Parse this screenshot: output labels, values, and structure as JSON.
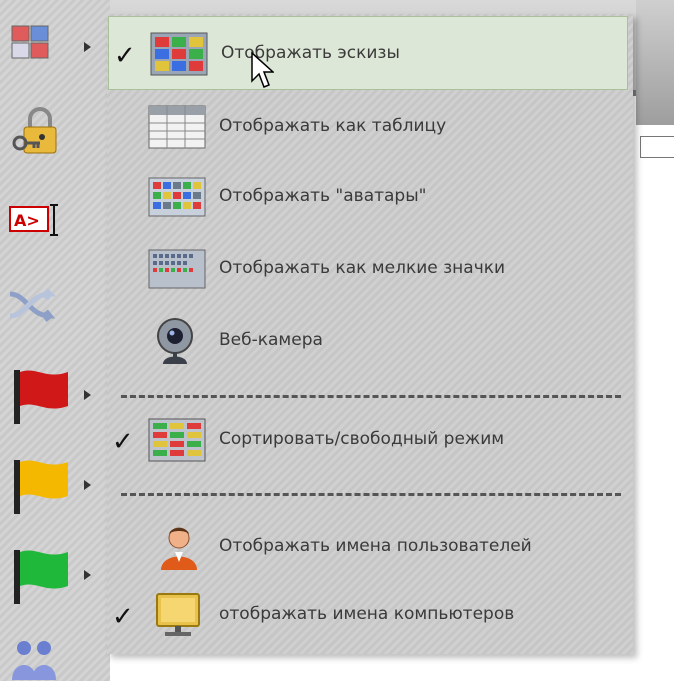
{
  "menu": {
    "items": [
      {
        "label": "Отображать эскизы",
        "checked": true,
        "icon": "thumbnails-icon"
      },
      {
        "label": "Отображать как таблицу",
        "checked": false,
        "icon": "table-view-icon"
      },
      {
        "label": "Отображать \"аватары\"",
        "checked": false,
        "icon": "avatars-icon"
      },
      {
        "label": "Отображать как мелкие значки",
        "checked": false,
        "icon": "small-icons-icon"
      },
      {
        "label": "Веб-камера",
        "checked": false,
        "icon": "webcam-icon"
      },
      {
        "label": "Сортировать/свободный режим",
        "checked": true,
        "icon": "sort-mode-icon"
      },
      {
        "label": "Отображать имена пользователей",
        "checked": false,
        "icon": "user-names-icon"
      },
      {
        "label": "отображать имена компьютеров",
        "checked": true,
        "icon": "computer-names-icon"
      }
    ],
    "check_glyph": "✓"
  },
  "toolbar": {
    "icons": [
      "view-mode-icon",
      "lock-key-icon",
      "text-input-icon",
      "shuffle-icon",
      "red-flag-icon",
      "yellow-flag-icon",
      "green-flag-icon",
      "users-icon"
    ]
  },
  "colors": {
    "hover_bg": "#dde7d7",
    "hover_border": "#a9c09a",
    "label_text": "#3a3a3a"
  }
}
